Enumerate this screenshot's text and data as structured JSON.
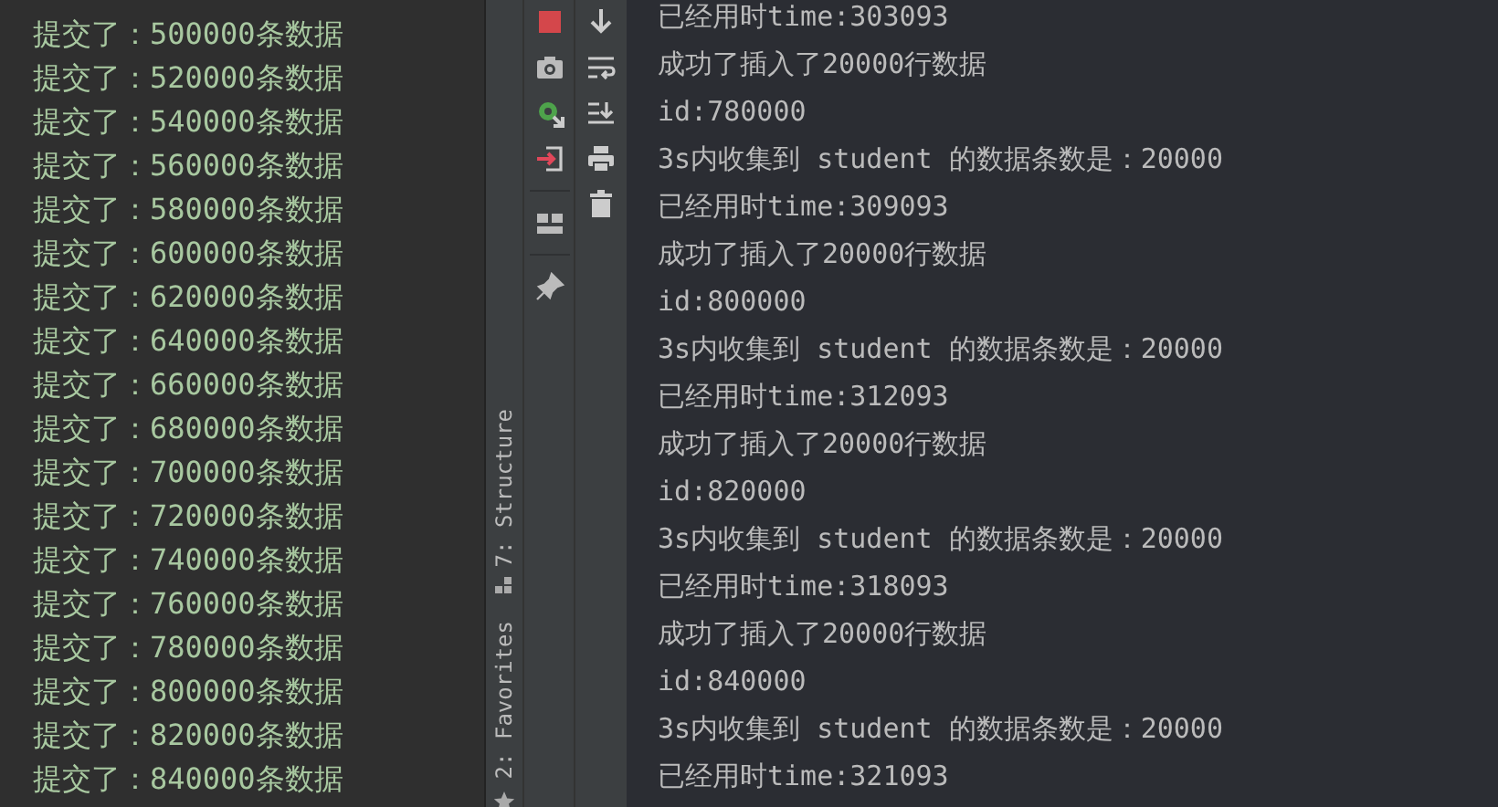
{
  "commit_log": {
    "lines": [
      "提交了：500000条数据",
      "提交了：520000条数据",
      "提交了：540000条数据",
      "提交了：560000条数据",
      "提交了：580000条数据",
      "提交了：600000条数据",
      "提交了：620000条数据",
      "提交了：640000条数据",
      "提交了：660000条数据",
      "提交了：680000条数据",
      "提交了：700000条数据",
      "提交了：720000条数据",
      "提交了：740000条数据",
      "提交了：760000条数据",
      "提交了：780000条数据",
      "提交了：800000条数据",
      "提交了：820000条数据",
      "提交了：840000条数据"
    ]
  },
  "side_tabs": [
    {
      "label": "7: Structure",
      "kind": "structure"
    },
    {
      "label": "2: Favorites",
      "kind": "favorites"
    }
  ],
  "console": {
    "lines": [
      "已经用时time:303093",
      "成功了插入了20000行数据",
      "id:780000",
      "3s内收集到 student 的数据条数是：20000",
      "已经用时time:309093",
      "成功了插入了20000行数据",
      "id:800000",
      "3s内收集到 student 的数据条数是：20000",
      "已经用时time:312093",
      "成功了插入了20000行数据",
      "id:820000",
      "3s内收集到 student 的数据条数是：20000",
      "已经用时time:318093",
      "成功了插入了20000行数据",
      "id:840000",
      "3s内收集到 student 的数据条数是：20000",
      "已经用时time:321093"
    ]
  }
}
